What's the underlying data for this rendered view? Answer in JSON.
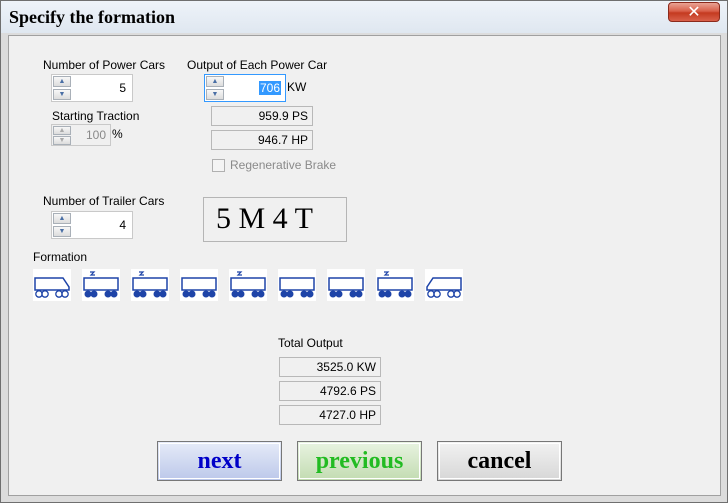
{
  "window": {
    "title": "Specify the formation",
    "close_glyph": "✕"
  },
  "power_cars": {
    "label": "Number of Power Cars",
    "value": "5"
  },
  "output": {
    "label": "Output of Each Power Car",
    "value": "706",
    "unit": "KW",
    "ps": "959.9 PS",
    "hp": "946.7 HP",
    "regen_label": "Regenerative Brake"
  },
  "starting_traction": {
    "label": "Starting Traction",
    "value": "100",
    "unit": "%"
  },
  "trailer_cars": {
    "label": "Number of Trailer Cars",
    "value": "4"
  },
  "formation_code": "5 M 4 T",
  "formation": {
    "label": "Formation",
    "cars": [
      "cab-trailer",
      "power",
      "power",
      "trailer",
      "power",
      "trailer",
      "trailer",
      "power",
      "cab-trailer"
    ]
  },
  "total": {
    "label": "Total Output",
    "kw": "3525.0 KW",
    "ps": "4792.6 PS",
    "hp": "4727.0 HP"
  },
  "buttons": {
    "next": "next",
    "previous": "previous",
    "cancel": "cancel"
  },
  "colors": {
    "next": "#0000c8",
    "previous": "#22bb22",
    "cancel": "#000000",
    "car": "#1e44a8"
  }
}
